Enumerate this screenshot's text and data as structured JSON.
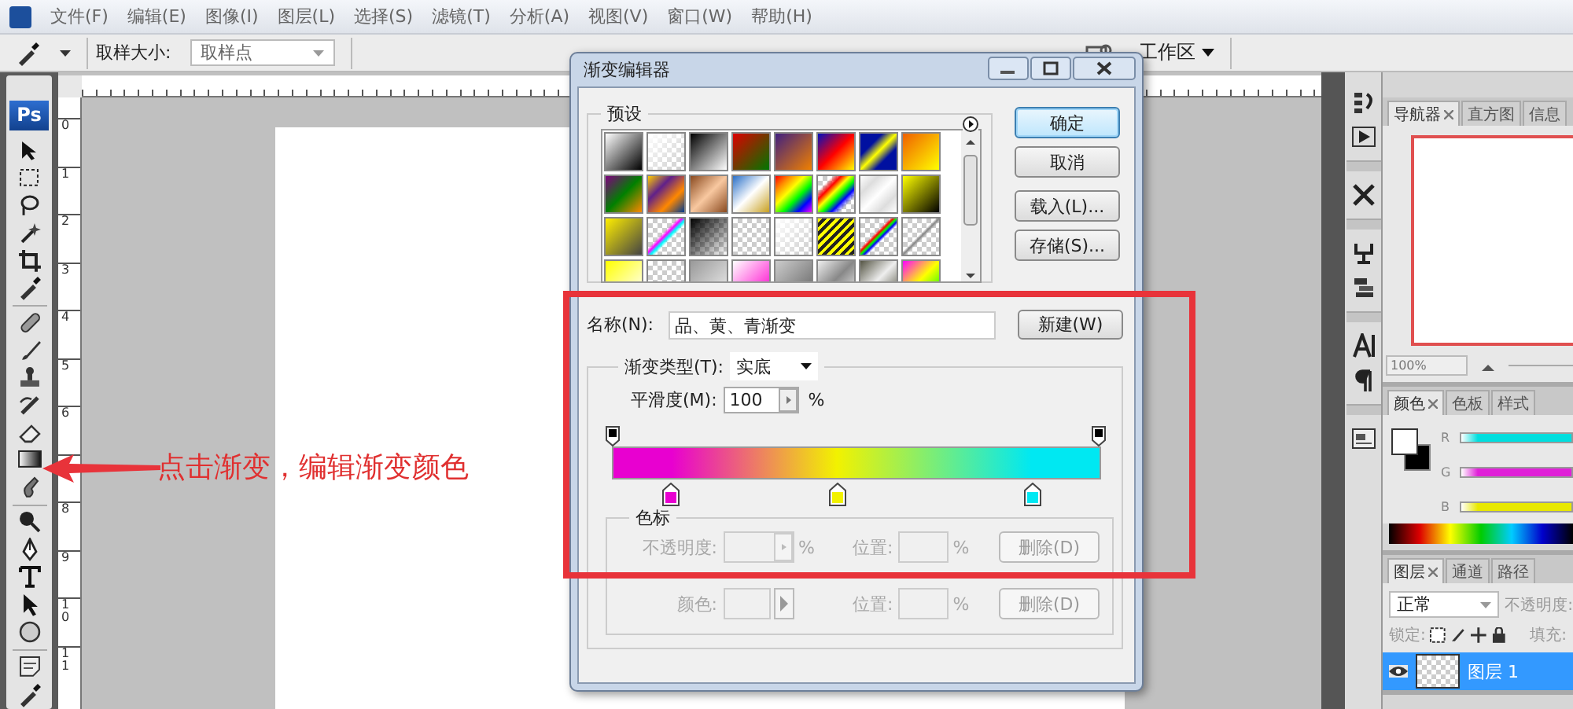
{
  "menu_bar": {
    "items": [
      "文件(F)",
      "编辑(E)",
      "图像(I)",
      "图层(L)",
      "选择(S)",
      "滤镜(T)",
      "分析(A)",
      "视图(V)",
      "窗口(W)",
      "帮助(H)"
    ]
  },
  "options_bar": {
    "sample_size_label": "取样大小:",
    "sample_size_value": "取样点",
    "workspace": "工作区"
  },
  "toolbar": {
    "logo": "Ps"
  },
  "left_ruler": {
    "labels_above_arrow": [
      "0",
      "1",
      "2",
      "3",
      "4",
      "5",
      "6"
    ],
    "labels_below_arrow": [
      "8",
      "9",
      "10",
      "11"
    ]
  },
  "annotation": {
    "text": "点击渐变，编辑渐变颜色"
  },
  "dialog": {
    "title": "渐变编辑器",
    "presets_label": "预设",
    "buttons": [
      {
        "label": "确定",
        "default": true
      },
      {
        "label": "取消",
        "default": false
      },
      {
        "label": "载入(L)...",
        "default": false
      },
      {
        "label": "存储(S)...",
        "default": false
      }
    ],
    "name_label": "名称(N):",
    "name_value": "品、黄、青渐变",
    "new_button": "新建(W)",
    "gradient_type_label": "渐变类型(T):",
    "gradient_type_value": "实底",
    "smoothness_label": "平滑度(M):",
    "smoothness_value": "100",
    "smoothness_unit": "%",
    "opacity_stops": [
      {
        "color": "#000000"
      },
      {
        "color": "#000000"
      }
    ],
    "color_stops": [
      {
        "color": "#e800d0"
      },
      {
        "color": "#f2f200"
      },
      {
        "color": "#00e8f2"
      }
    ],
    "stops_group": {
      "label": "色标",
      "rows": [
        {
          "kind": "opacity",
          "label": "不透明度:",
          "unit": "%",
          "position_label": "位置:",
          "position_unit": "%",
          "delete_button": "删除(D)",
          "disabled": true
        },
        {
          "kind": "color",
          "label": "颜色:",
          "position_label": "位置:",
          "position_unit": "%",
          "delete_button": "删除(D)",
          "disabled": true
        }
      ]
    }
  },
  "navigator_panel": {
    "tabs": [
      {
        "label": "导航器",
        "selected": true
      },
      {
        "label": "直方图",
        "selected": false
      },
      {
        "label": "信息",
        "selected": false
      }
    ],
    "zoom": "100%"
  },
  "color_panel": {
    "tabs": [
      {
        "label": "颜色",
        "selected": true
      },
      {
        "label": "色板",
        "selected": false
      },
      {
        "label": "样式",
        "selected": false
      }
    ],
    "channels": [
      {
        "label": "R",
        "color": "#00dede"
      },
      {
        "label": "G",
        "color": "#e020d8"
      },
      {
        "label": "B",
        "color": "#e8e800"
      }
    ]
  },
  "layers_panel": {
    "tabs": [
      {
        "label": "图层",
        "selected": true
      },
      {
        "label": "通道",
        "selected": false
      },
      {
        "label": "路径",
        "selected": false
      }
    ],
    "blend_mode": "正常",
    "opacity_label": "不透明度:",
    "lock_label": "锁定:",
    "fill_label": "填充:",
    "layers": [
      {
        "name": "图层 1",
        "selected": true,
        "visible": true
      }
    ]
  }
}
